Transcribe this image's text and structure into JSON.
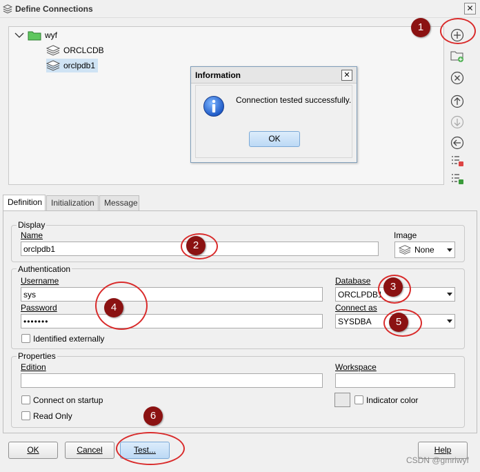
{
  "window": {
    "title": "Define Connections",
    "close_glyph": "✕"
  },
  "tree": {
    "root": {
      "label": "wyf",
      "icon": "folder-icon"
    },
    "items": [
      {
        "label": "ORCLCDB",
        "icon": "database-icon"
      },
      {
        "label": "orclpdb1",
        "icon": "database-icon",
        "selected": true
      }
    ]
  },
  "toolbar": {
    "buttons": [
      "add-icon",
      "new-folder-icon",
      "remove-icon",
      "move-up-icon",
      "move-down-icon",
      "back-icon",
      "export-list-icon",
      "import-list-icon"
    ]
  },
  "dialog": {
    "title": "Information",
    "close_glyph": "✕",
    "message": "Connection tested successfully.",
    "ok_label": "OK"
  },
  "tabs": [
    "Definition",
    "Initialization",
    "Message"
  ],
  "display": {
    "group_label": "Display",
    "name_label": "Name",
    "name_value": "orclpdb1",
    "image_label": "Image",
    "image_value": "None"
  },
  "authentication": {
    "group_label": "Authentication",
    "username_label": "Username",
    "username_value": "sys",
    "password_label": "Password",
    "password_value": "•••••••",
    "database_label": "Database",
    "database_value": "ORCLPDB1",
    "connect_as_label": "Connect as",
    "connect_as_value": "SYSDBA",
    "identified_externally_label": "Identified externally"
  },
  "properties": {
    "group_label": "Properties",
    "edition_label": "Edition",
    "edition_value": "",
    "workspace_label": "Workspace",
    "workspace_value": "",
    "connect_on_startup_label": "Connect on startup",
    "read_only_label": "Read Only",
    "indicator_color_label": "Indicator color"
  },
  "buttons": {
    "ok": "OK",
    "cancel": "Cancel",
    "test": "Test...",
    "help": "Help"
  },
  "annotations": [
    "1",
    "2",
    "3",
    "4",
    "5",
    "6"
  ],
  "watermark": "CSDN @gmriwyf",
  "colors": {
    "annotation": "#8b1212",
    "ring": "#d92b2b",
    "selection": "#cfe3f4",
    "folder": "#4caf50"
  }
}
